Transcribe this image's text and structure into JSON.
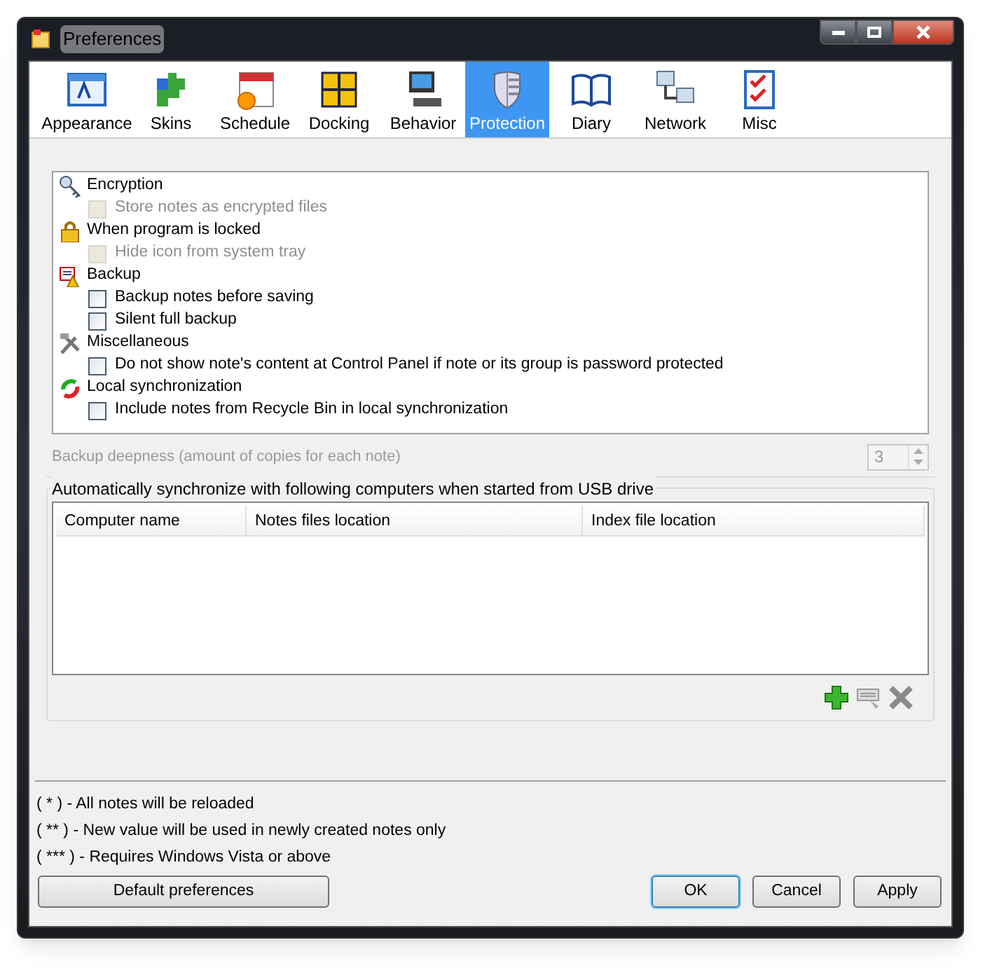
{
  "window": {
    "title": "Preferences"
  },
  "tabs": [
    {
      "label": "Appearance",
      "selected": false
    },
    {
      "label": "Skins",
      "selected": false
    },
    {
      "label": "Schedule",
      "selected": false
    },
    {
      "label": "Docking",
      "selected": false
    },
    {
      "label": "Behavior",
      "selected": false
    },
    {
      "label": "Protection",
      "selected": true
    },
    {
      "label": "Diary",
      "selected": false
    },
    {
      "label": "Network",
      "selected": false
    },
    {
      "label": "Misc",
      "selected": false
    }
  ],
  "options": [
    {
      "heading": "Encryption",
      "items": [
        {
          "label": "Store notes as encrypted files",
          "checked": false,
          "disabled": true
        }
      ]
    },
    {
      "heading": "When program is locked",
      "items": [
        {
          "label": "Hide icon from system tray",
          "checked": false,
          "disabled": true
        }
      ]
    },
    {
      "heading": "Backup",
      "items": [
        {
          "label": "Backup notes before saving",
          "checked": false,
          "disabled": false
        },
        {
          "label": "Silent full backup",
          "checked": false,
          "disabled": false
        }
      ]
    },
    {
      "heading": "Miscellaneous",
      "items": [
        {
          "label": "Do not show note's content at Control Panel if note or its group is password protected",
          "checked": false,
          "disabled": false
        }
      ]
    },
    {
      "heading": "Local synchronization",
      "items": [
        {
          "label": "Include notes from Recycle Bin in local synchronization",
          "checked": false,
          "disabled": false
        }
      ]
    }
  ],
  "backup_deepness": {
    "label": "Backup deepness (amount of copies for each note)",
    "value": "3",
    "disabled": true
  },
  "sync": {
    "title": "Automatically synchronize with following computers when started from USB drive",
    "columns": [
      "Computer name",
      "Notes files location",
      "Index file location"
    ]
  },
  "notes": [
    "( * ) - All notes will be reloaded",
    "( ** ) - New value will be used in newly created notes only",
    "( *** ) - Requires Windows Vista or above"
  ],
  "buttons": [
    {
      "label": "Default preferences",
      "kind": "default"
    },
    {
      "label": "OK",
      "kind": "primary"
    },
    {
      "label": "Cancel",
      "kind": "normal"
    },
    {
      "label": "Apply",
      "kind": "normal"
    }
  ]
}
